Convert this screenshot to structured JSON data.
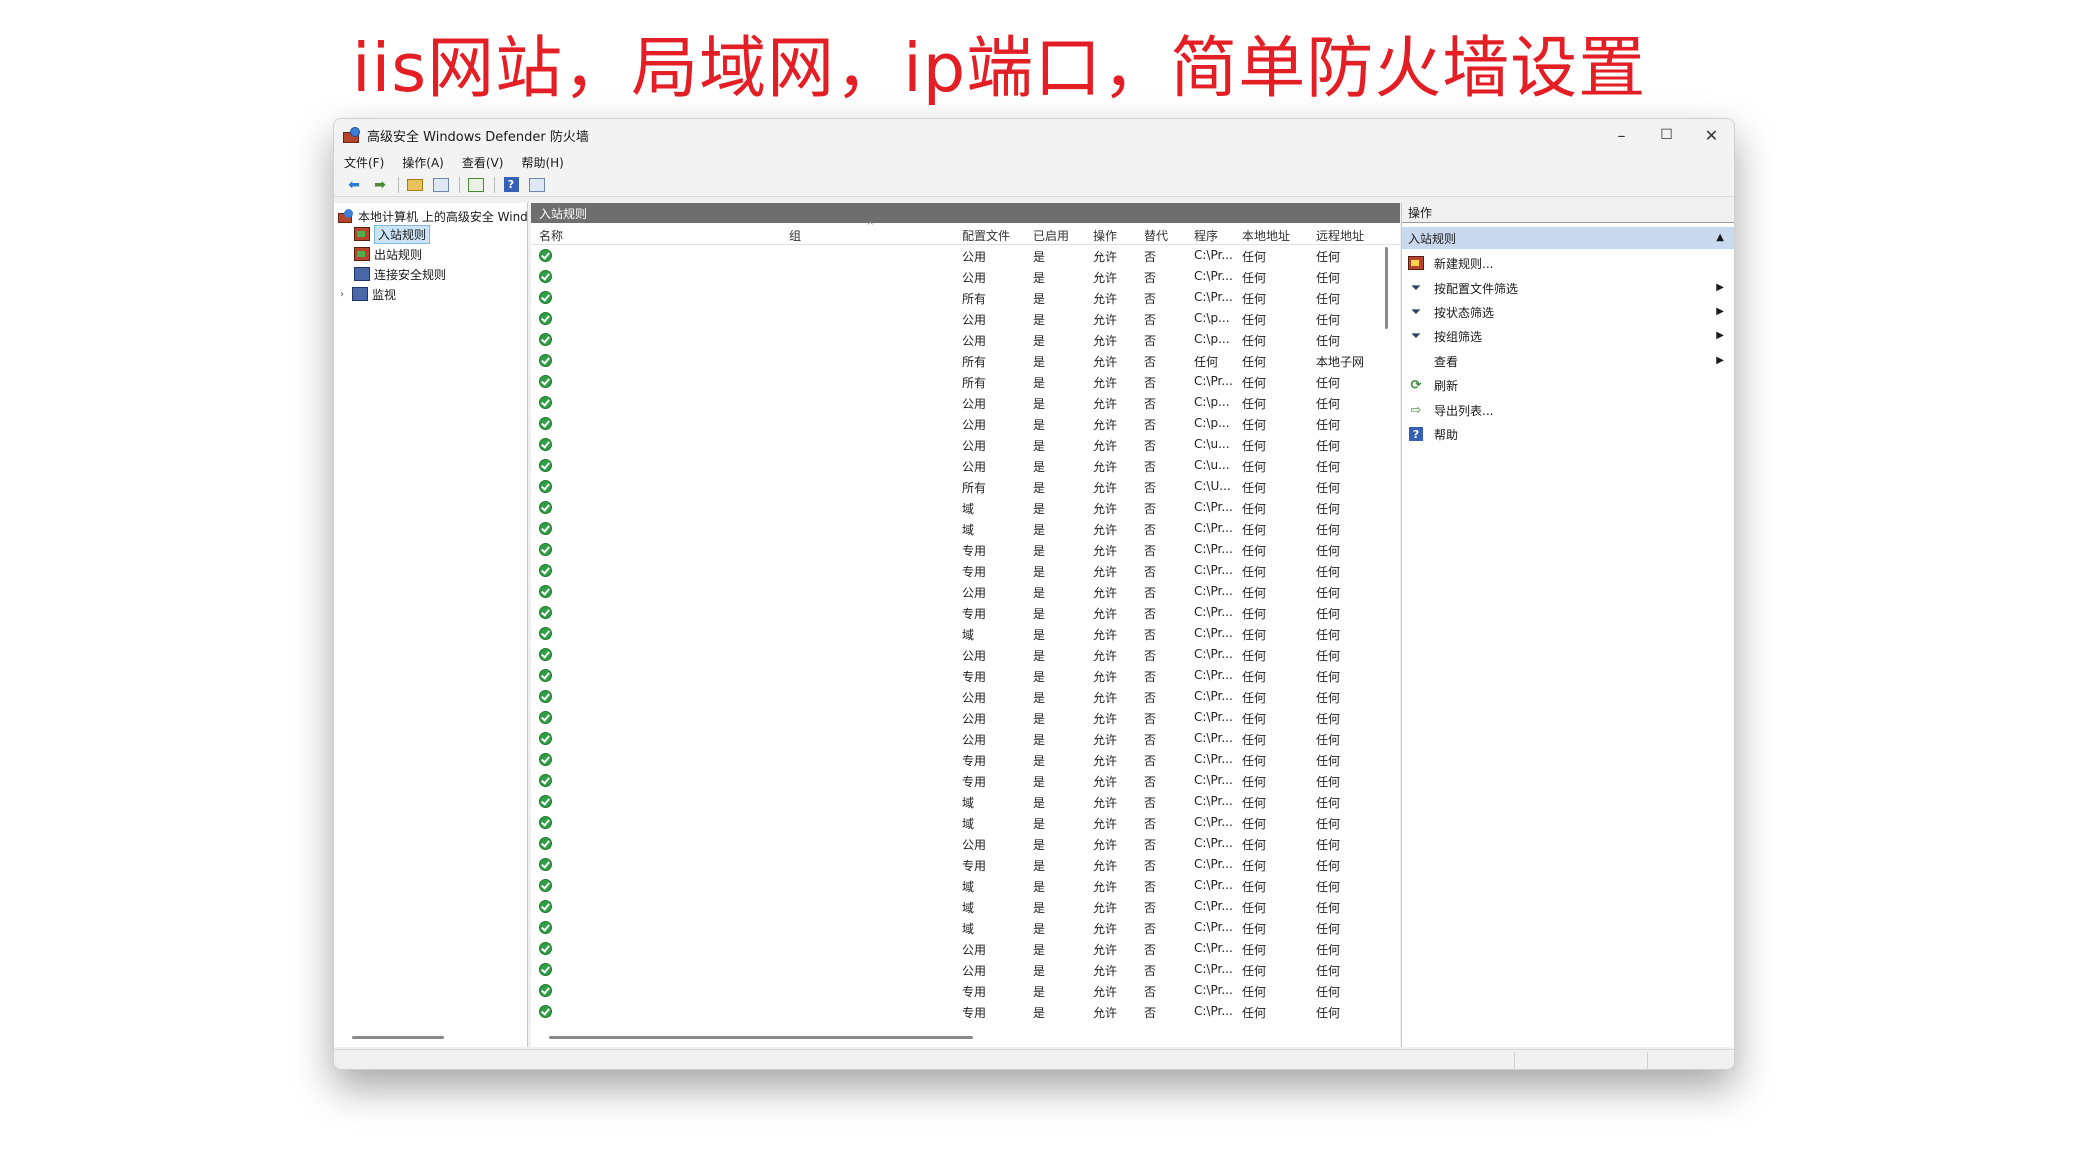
{
  "banner": {
    "text": "iis网站，局域网，ip端口，简单防火墙设置"
  },
  "window": {
    "title": "高级安全 Windows Defender 防火墙",
    "controls": {
      "minimize": "–",
      "maximize": "☐",
      "close": "✕"
    }
  },
  "menu": [
    "文件(F)",
    "操作(A)",
    "查看(V)",
    "帮助(H)"
  ],
  "tree": {
    "root": "本地计算机 上的高级安全 Windows Defender 防火墙",
    "items": [
      "入站规则",
      "出站规则",
      "连接安全规则",
      "监视"
    ],
    "expander": "›"
  },
  "center": {
    "header": "入站规则",
    "columns": [
      "名称",
      "组",
      "配置文件",
      "已启用",
      "操作",
      "替代",
      "程序",
      "本地地址",
      "远程地址"
    ],
    "sort_indicator": "^",
    "rows": [
      [
        "公用",
        "是",
        "允许",
        "否",
        "C:\\Pr...",
        "任何",
        "任何"
      ],
      [
        "公用",
        "是",
        "允许",
        "否",
        "C:\\Pr...",
        "任何",
        "任何"
      ],
      [
        "所有",
        "是",
        "允许",
        "否",
        "C:\\Pr...",
        "任何",
        "任何"
      ],
      [
        "公用",
        "是",
        "允许",
        "否",
        "C:\\p...",
        "任何",
        "任何"
      ],
      [
        "公用",
        "是",
        "允许",
        "否",
        "C:\\p...",
        "任何",
        "任何"
      ],
      [
        "所有",
        "是",
        "允许",
        "否",
        "任何",
        "任何",
        "本地子网"
      ],
      [
        "所有",
        "是",
        "允许",
        "否",
        "C:\\Pr...",
        "任何",
        "任何"
      ],
      [
        "公用",
        "是",
        "允许",
        "否",
        "C:\\p...",
        "任何",
        "任何"
      ],
      [
        "公用",
        "是",
        "允许",
        "否",
        "C:\\p...",
        "任何",
        "任何"
      ],
      [
        "公用",
        "是",
        "允许",
        "否",
        "C:\\u...",
        "任何",
        "任何"
      ],
      [
        "公用",
        "是",
        "允许",
        "否",
        "C:\\u...",
        "任何",
        "任何"
      ],
      [
        "所有",
        "是",
        "允许",
        "否",
        "C:\\U...",
        "任何",
        "任何"
      ],
      [
        "域",
        "是",
        "允许",
        "否",
        "C:\\Pr...",
        "任何",
        "任何"
      ],
      [
        "域",
        "是",
        "允许",
        "否",
        "C:\\Pr...",
        "任何",
        "任何"
      ],
      [
        "专用",
        "是",
        "允许",
        "否",
        "C:\\Pr...",
        "任何",
        "任何"
      ],
      [
        "专用",
        "是",
        "允许",
        "否",
        "C:\\Pr...",
        "任何",
        "任何"
      ],
      [
        "公用",
        "是",
        "允许",
        "否",
        "C:\\Pr...",
        "任何",
        "任何"
      ],
      [
        "专用",
        "是",
        "允许",
        "否",
        "C:\\Pr...",
        "任何",
        "任何"
      ],
      [
        "域",
        "是",
        "允许",
        "否",
        "C:\\Pr...",
        "任何",
        "任何"
      ],
      [
        "公用",
        "是",
        "允许",
        "否",
        "C:\\Pr...",
        "任何",
        "任何"
      ],
      [
        "专用",
        "是",
        "允许",
        "否",
        "C:\\Pr...",
        "任何",
        "任何"
      ],
      [
        "公用",
        "是",
        "允许",
        "否",
        "C:\\Pr...",
        "任何",
        "任何"
      ],
      [
        "公用",
        "是",
        "允许",
        "否",
        "C:\\Pr...",
        "任何",
        "任何"
      ],
      [
        "公用",
        "是",
        "允许",
        "否",
        "C:\\Pr...",
        "任何",
        "任何"
      ],
      [
        "专用",
        "是",
        "允许",
        "否",
        "C:\\Pr...",
        "任何",
        "任何"
      ],
      [
        "专用",
        "是",
        "允许",
        "否",
        "C:\\Pr...",
        "任何",
        "任何"
      ],
      [
        "域",
        "是",
        "允许",
        "否",
        "C:\\Pr...",
        "任何",
        "任何"
      ],
      [
        "域",
        "是",
        "允许",
        "否",
        "C:\\Pr...",
        "任何",
        "任何"
      ],
      [
        "公用",
        "是",
        "允许",
        "否",
        "C:\\Pr...",
        "任何",
        "任何"
      ],
      [
        "专用",
        "是",
        "允许",
        "否",
        "C:\\Pr...",
        "任何",
        "任何"
      ],
      [
        "域",
        "是",
        "允许",
        "否",
        "C:\\Pr...",
        "任何",
        "任何"
      ],
      [
        "域",
        "是",
        "允许",
        "否",
        "C:\\Pr...",
        "任何",
        "任何"
      ],
      [
        "域",
        "是",
        "允许",
        "否",
        "C:\\Pr...",
        "任何",
        "任何"
      ],
      [
        "公用",
        "是",
        "允许",
        "否",
        "C:\\Pr...",
        "任何",
        "任何"
      ],
      [
        "公用",
        "是",
        "允许",
        "否",
        "C:\\Pr...",
        "任何",
        "任何"
      ],
      [
        "专用",
        "是",
        "允许",
        "否",
        "C:\\Pr...",
        "任何",
        "任何"
      ],
      [
        "专用",
        "是",
        "允许",
        "否",
        "C:\\Pr...",
        "任何",
        "任何"
      ]
    ]
  },
  "actions": {
    "header": "操作",
    "section": "入站规则",
    "collapse": "▲",
    "submenu": "▶",
    "items": [
      {
        "label": "新建规则...",
        "icon": "new-rule-icon",
        "submenu": false
      },
      {
        "label": "按配置文件筛选",
        "icon": "filter-icon",
        "submenu": true
      },
      {
        "label": "按状态筛选",
        "icon": "filter-icon",
        "submenu": true
      },
      {
        "label": "按组筛选",
        "icon": "filter-icon",
        "submenu": true
      },
      {
        "label": "查看",
        "icon": "",
        "submenu": true
      },
      {
        "label": "刷新",
        "icon": "refresh-icon",
        "submenu": false
      },
      {
        "label": "导出列表...",
        "icon": "export-icon",
        "submenu": false
      },
      {
        "label": "帮助",
        "icon": "help-icon",
        "submenu": false
      }
    ]
  },
  "colors": {
    "banner": "#e41e25",
    "header_bar": "#6e6e6e",
    "selection": "#cce4f7",
    "actions_section": "#c9daf0"
  }
}
